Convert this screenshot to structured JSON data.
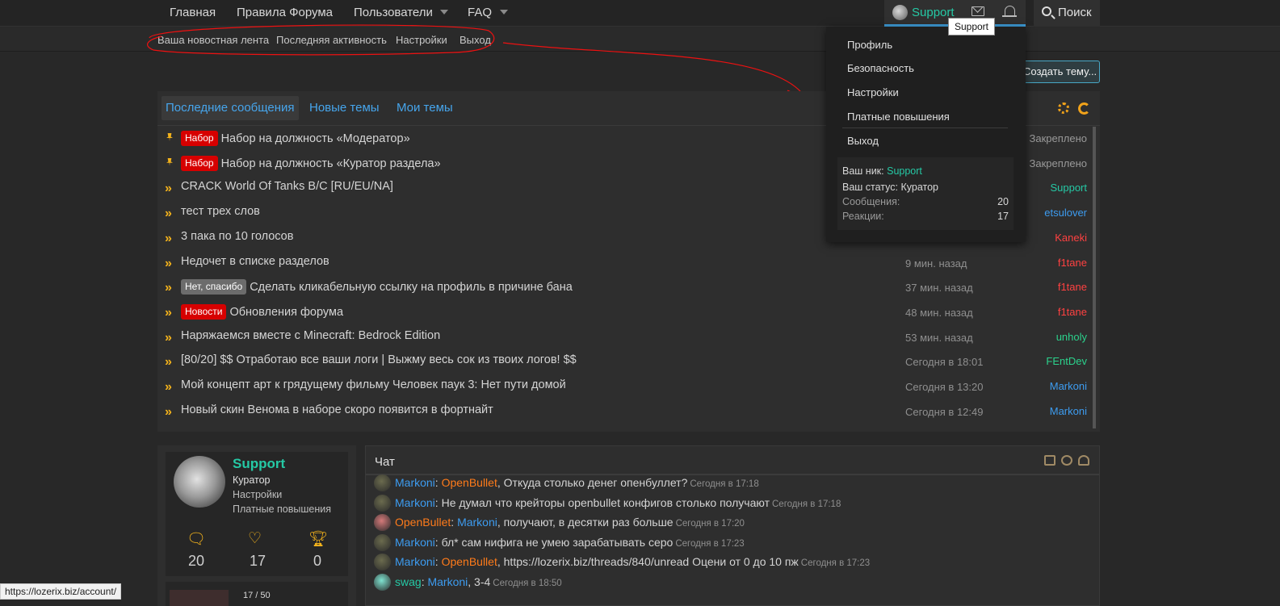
{
  "nav": {
    "items": [
      {
        "label": "Главная"
      },
      {
        "label": "Правила Форума"
      },
      {
        "label": "Пользователи"
      },
      {
        "label": "FAQ"
      }
    ],
    "user_name": "Support",
    "search_label": "Поиск",
    "tooltip": "Support"
  },
  "subnav": {
    "items": [
      "Ваша новостная лента",
      "Последняя активность",
      "Настройки",
      "Выход"
    ]
  },
  "create_button": "Создать тему...",
  "tabs": [
    "Последние сообщения",
    "Новые темы",
    "Мои темы"
  ],
  "threads": [
    {
      "icon": "pin",
      "prefix": "Набор",
      "prefix_color": "#d70000",
      "title": "Набор на должность «Модератор»",
      "time": "",
      "author": "Закреплено",
      "author_color": "#9a9a9a"
    },
    {
      "icon": "pin",
      "prefix": "Набор",
      "prefix_color": "#d70000",
      "title": "Набор на должность «Куратор раздела»",
      "time": "",
      "author": "Закреплено",
      "author_color": "#9a9a9a"
    },
    {
      "icon": "chevrons",
      "prefix": "",
      "title": "CRACK World Of Tanks B/C [RU/EU/NA]",
      "time": "",
      "author": "Support",
      "author_color": "#25c9a5"
    },
    {
      "icon": "chevrons",
      "prefix": "",
      "title": "тест трех слов",
      "time": "",
      "author": "etsulover",
      "author_color": "#3d9cf0"
    },
    {
      "icon": "chevrons",
      "prefix": "",
      "title": "3 пака по 10 голосов",
      "time": "",
      "author": "Kaneki",
      "author_color": "#ff4141"
    },
    {
      "icon": "chevrons",
      "prefix": "",
      "title": "Недочет в списке разделов",
      "time": "9 мин. назад",
      "author": "f1tane",
      "author_color": "#ff4141"
    },
    {
      "icon": "chevrons",
      "prefix": "Нет, спасибо",
      "prefix_color": "#6c6c6c",
      "title": "Сделать кликабельную ссылку на профиль в причине бана",
      "time": "37 мин. назад",
      "author": "f1tane",
      "author_color": "#ff4141"
    },
    {
      "icon": "chevrons",
      "prefix": "Новости",
      "prefix_color": "#d70000",
      "title": "Обновления форума",
      "time": "48 мин. назад",
      "author": "f1tane",
      "author_color": "#ff4141"
    },
    {
      "icon": "chevrons",
      "prefix": "",
      "title": "Наряжаемся вместе с Minecraft: Bedrock Edition",
      "time": "53 мин. назад",
      "author": "unholy",
      "author_color": "#2bd28c"
    },
    {
      "icon": "chevrons",
      "prefix": "",
      "title": "[80/20] $$ Отработаю все ваши логи | Выжму весь сок из твоих логов! $$",
      "time": "Сегодня в 18:01",
      "author": "FEntDev",
      "author_color": "#2bd28c"
    },
    {
      "icon": "chevrons",
      "prefix": "",
      "title": "Мой концепт арт к грядущему фильму Человек паук 3: Нет пути домой",
      "time": "Сегодня в 13:20",
      "author": "Markoni",
      "author_color": "#3d9cf0"
    },
    {
      "icon": "chevrons",
      "prefix": "",
      "title": "Новый скин Венома в наборе скоро появится в фортнайт",
      "time": "Сегодня в 12:49",
      "author": "Markoni",
      "author_color": "#3d9cf0"
    }
  ],
  "dropdown": {
    "items": [
      "Профиль",
      "Безопасность",
      "Настройки",
      "Платные повышения",
      "Выход"
    ],
    "nick_label": "Ваш ник:",
    "nick_value": "Support",
    "status_line": "Ваш статус: Куратор",
    "messages_label": "Сообщения:",
    "messages_value": "20",
    "reactions_label": "Реакции:",
    "reactions_value": "17"
  },
  "profile": {
    "name": "Support",
    "title": "Куратор",
    "link1": "Настройки",
    "link2": "Платные повышения",
    "stats": [
      "20",
      "17",
      "0"
    ],
    "progress_text": "17 / 50",
    "progress_fraction": 0.34
  },
  "chat": {
    "title": "Чат",
    "messages": [
      {
        "user": "Markoni",
        "user_color": "#3d9cf0",
        "sep": ": ",
        "to": "OpenBullet",
        "to_color": "#ff7b1a",
        "text": ", Откуда столько денег опенбуллет?",
        "time": "Сегодня в 17:18"
      },
      {
        "user": "Markoni",
        "user_color": "#3d9cf0",
        "sep": ": ",
        "to": "",
        "to_color": "",
        "text": "Не думал что крейторы openbullet конфигов столько получают",
        "time": "Сегодня в 17:18"
      },
      {
        "user": "OpenBullet",
        "user_color": "#ff7b1a",
        "sep": ": ",
        "to": "Markoni",
        "to_color": "#3d9cf0",
        "text": ", получают, в десятки раз больше",
        "time": "Сегодня в 17:20"
      },
      {
        "user": "Markoni",
        "user_color": "#3d9cf0",
        "sep": ": ",
        "to": "",
        "to_color": "",
        "text": "бл* сам нифига не умею зарабатывать серо",
        "time": "Сегодня в 17:23"
      },
      {
        "user": "Markoni",
        "user_color": "#3d9cf0",
        "sep": ": ",
        "to": "OpenBullet",
        "to_color": "#ff7b1a",
        "text": ", https://lozerix.biz/threads/840/unread Оцени от 0 до 10 пж",
        "time": "Сегодня в 17:23"
      },
      {
        "user": "swag",
        "user_color": "#25c9a5",
        "sep": ": ",
        "to": "Markoni",
        "to_color": "#3d9cf0",
        "text": ", 3-4",
        "time": "Сегодня в 18:50"
      }
    ]
  },
  "status_url": "https://lozerix.biz/account/"
}
